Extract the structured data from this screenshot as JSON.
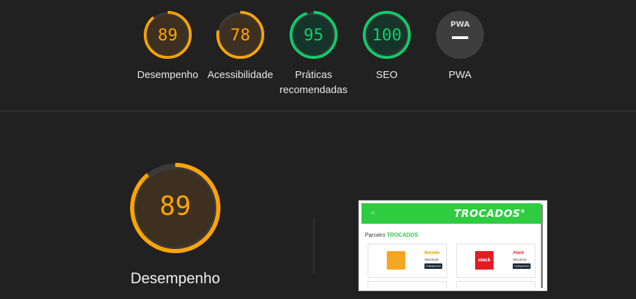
{
  "colors": {
    "background": "#212121",
    "average": "#ffa400",
    "average_fill": "#3d3020",
    "pass": "#0cce6b",
    "pass_fill": "#17342a",
    "pwa_fill": "#3e3e3e",
    "track": "#3a3a3a"
  },
  "categories": [
    {
      "score": "89",
      "value": 89,
      "label": "Desempenho",
      "status": "average"
    },
    {
      "score": "78",
      "value": 78,
      "label": "Acessibilidade",
      "status": "average"
    },
    {
      "score": "95",
      "value": 95,
      "label": "Práticas recomendadas",
      "status": "pass"
    },
    {
      "score": "100",
      "value": 100,
      "label": "SEO",
      "status": "pass"
    },
    {
      "score": "",
      "value": null,
      "label": "PWA",
      "status": "pwa",
      "badge": "PWA",
      "icon": "pwa-dash-icon"
    }
  ],
  "main": {
    "score": "89",
    "value": 89,
    "label": "Desempenho"
  },
  "screenshot": {
    "brand": "TROCADOS",
    "brand_mark": "®",
    "partner_prefix": "Parceiro",
    "partner_brand": "TROCADOS",
    "cards": [
      {
        "name": "Baratão",
        "sub": "atacarejo",
        "button": "Indisponível",
        "logo_color": "#f5a623"
      },
      {
        "name": "Atack",
        "sub": "atacarejo",
        "button": "Indisponível",
        "logo_color": "#e31b23",
        "logo_text": "atack"
      }
    ]
  }
}
